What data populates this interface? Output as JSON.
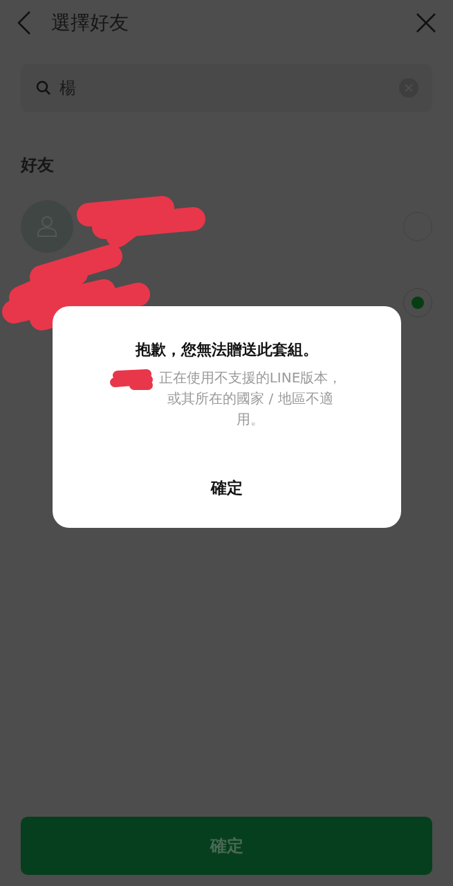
{
  "header": {
    "title": "選擇好友"
  },
  "search": {
    "value": "楊"
  },
  "section": {
    "label": "好友"
  },
  "friends": [
    {
      "has_avatar": true,
      "selected": false
    },
    {
      "has_avatar": false,
      "selected": true
    }
  ],
  "dialog": {
    "title": "抱歉，您無法贈送此套組。",
    "message": "正在使用不支援的LINE版本，或其所在的國家 / 地區不適用。",
    "button": "確定"
  },
  "confirm_button": {
    "label": "確定",
    "disabled": true
  }
}
